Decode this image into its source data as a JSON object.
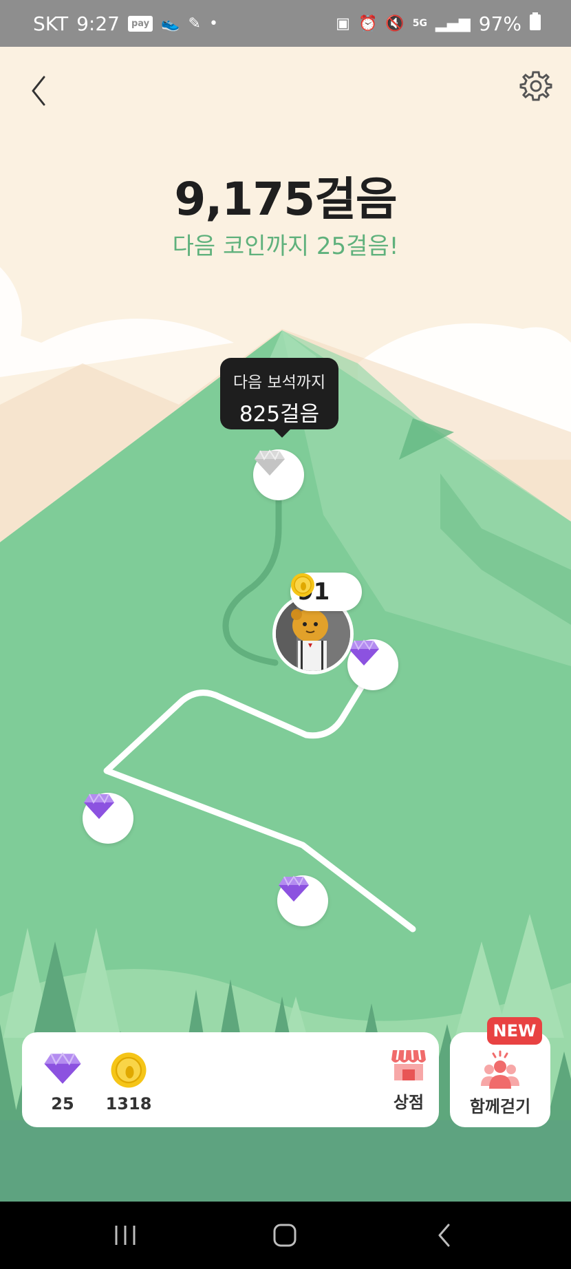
{
  "status_bar": {
    "carrier": "SKT",
    "time": "9:27",
    "pay_badge": "pay",
    "network": "5G",
    "battery": "97%"
  },
  "header": {
    "back_icon": "chevron-left-icon",
    "settings_icon": "gear-icon"
  },
  "steps": {
    "title": "9,175걸음",
    "subtitle": "다음 코인까지 25걸음!"
  },
  "tooltip": {
    "line1": "다음 보석까지",
    "line2": "825걸음"
  },
  "avatar": {
    "coins": "91"
  },
  "wallet": {
    "gems": "25",
    "coins": "1318",
    "shop_label": "상점"
  },
  "together": {
    "label": "함께걷기",
    "badge": "NEW"
  },
  "colors": {
    "accent_green": "#5fb17c",
    "mountain": "#7fcc98",
    "sky": "#fbf1e1",
    "gem": "#9b5de5",
    "coin": "#f5c518",
    "badge_red": "#e84242"
  }
}
